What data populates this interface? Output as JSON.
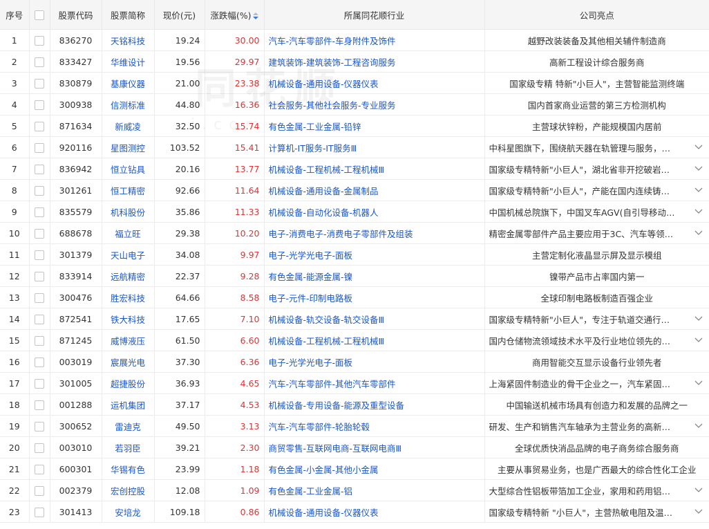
{
  "columns": {
    "index": "序号",
    "code": "股票代码",
    "name": "股票简称",
    "price": "现价(元)",
    "change": "涨跌幅(%)",
    "industry": "所属同花顺行业",
    "highlight": "公司亮点"
  },
  "watermark": "同花顺",
  "watermark_sub": "i.com",
  "sort": {
    "column": "change",
    "direction": "descending"
  },
  "colors": {
    "link": "#1a56c8",
    "rise": "#e93030",
    "header_bg": "#f5f5f5"
  },
  "rows": [
    {
      "idx": "1",
      "code": "836270",
      "name": "天铭科技",
      "price": "19.24",
      "change": "30.00",
      "industry": "汽车-汽车零部件-车身附件及饰件",
      "highlight": "越野改装装备及其他相关辅件制造商",
      "truncated": false
    },
    {
      "idx": "2",
      "code": "833427",
      "name": "华维设计",
      "price": "19.56",
      "change": "29.97",
      "industry": "建筑装饰-建筑装饰-工程咨询服务",
      "highlight": "高新工程设计综合服务商",
      "truncated": false
    },
    {
      "idx": "3",
      "code": "830879",
      "name": "基康仪器",
      "price": "21.00",
      "change": "23.38",
      "industry": "机械设备-通用设备-仪器仪表",
      "highlight": "国家级专精 特新\"小巨人\"，主营智能监测终端",
      "truncated": false
    },
    {
      "idx": "4",
      "code": "300938",
      "name": "信测标准",
      "price": "44.80",
      "change": "16.36",
      "industry": "社会服务-其他社会服务-专业服务",
      "highlight": "国内首家商业运营的第三方检测机构",
      "truncated": false
    },
    {
      "idx": "5",
      "code": "871634",
      "name": "新威凌",
      "price": "32.50",
      "change": "15.74",
      "industry": "有色金属-工业金属-铅锌",
      "highlight": "主营球状锌粉，产能规模国内居前",
      "truncated": false
    },
    {
      "idx": "6",
      "code": "920116",
      "name": "星图测控",
      "price": "103.52",
      "change": "15.41",
      "industry": "计算机-IT服务-IT服务Ⅲ",
      "highlight": "中科星图旗下，围绕航天器在轨管理与服务，…",
      "truncated": true
    },
    {
      "idx": "7",
      "code": "836942",
      "name": "恒立钻具",
      "price": "20.16",
      "change": "13.77",
      "industry": "机械设备-工程机械-工程机械Ⅲ",
      "highlight": "国家级专精特新\"小巨人\"，湖北省非开挖破岩…",
      "truncated": true
    },
    {
      "idx": "8",
      "code": "301261",
      "name": "恒工精密",
      "price": "92.66",
      "change": "11.64",
      "industry": "机械设备-通用设备-金属制品",
      "highlight": "国家级专精特新\"小巨人\"，产能在国内连续铸…",
      "truncated": true
    },
    {
      "idx": "9",
      "code": "835579",
      "name": "机科股份",
      "price": "35.86",
      "change": "11.33",
      "industry": "机械设备-自动化设备-机器人",
      "highlight": "中国机械总院旗下，中国叉车AGV(自引导移动…",
      "truncated": true
    },
    {
      "idx": "10",
      "code": "688678",
      "name": "福立旺",
      "price": "29.38",
      "change": "10.20",
      "industry": "电子-消费电子-消费电子零部件及组装",
      "highlight": "精密金属零部件产品主要应用于3C、汽车等领…",
      "truncated": true
    },
    {
      "idx": "11",
      "code": "301379",
      "name": "天山电子",
      "price": "34.08",
      "change": "9.97",
      "industry": "电子-光学光电子-面板",
      "highlight": "主营定制化液晶显示屏及显示模组",
      "truncated": false
    },
    {
      "idx": "12",
      "code": "833914",
      "name": "远航精密",
      "price": "22.37",
      "change": "9.28",
      "industry": "有色金属-能源金属-镍",
      "highlight": "镍带产品市占率国内第一",
      "truncated": false
    },
    {
      "idx": "13",
      "code": "300476",
      "name": "胜宏科技",
      "price": "64.66",
      "change": "8.58",
      "industry": "电子-元件-印制电路板",
      "highlight": "全球印制电路板制造百强企业",
      "truncated": false
    },
    {
      "idx": "14",
      "code": "872541",
      "name": "铁大科技",
      "price": "17.65",
      "change": "7.10",
      "industry": "机械设备-轨交设备-轨交设备Ⅲ",
      "highlight": "国家级专精特新\"小巨人\"，专注于轨道交通行…",
      "truncated": true
    },
    {
      "idx": "15",
      "code": "871245",
      "name": "威博液压",
      "price": "61.50",
      "change": "6.60",
      "industry": "机械设备-工程机械-工程机械Ⅲ",
      "highlight": "国内仓储物流领域技术水平及行业地位领先的…",
      "truncated": true
    },
    {
      "idx": "16",
      "code": "003019",
      "name": "宸展光电",
      "price": "37.30",
      "change": "6.36",
      "industry": "电子-光学光电子-面板",
      "highlight": "商用智能交互显示设备行业领先者",
      "truncated": false
    },
    {
      "idx": "17",
      "code": "301005",
      "name": "超捷股份",
      "price": "36.93",
      "change": "4.65",
      "industry": "汽车-汽车零部件-其他汽车零部件",
      "highlight": "上海紧固件制造业的骨干企业之一，汽车紧固…",
      "truncated": true
    },
    {
      "idx": "18",
      "code": "001288",
      "name": "运机集团",
      "price": "37.17",
      "change": "4.53",
      "industry": "机械设备-专用设备-能源及重型设备",
      "highlight": "中国输送机械市场具有创造力和发展的品牌之一",
      "truncated": false
    },
    {
      "idx": "19",
      "code": "300652",
      "name": "雷迪克",
      "price": "49.50",
      "change": "3.13",
      "industry": "汽车-汽车零部件-轮胎轮毂",
      "highlight": "研发、生产和销售汽车轴承为主营业务的高新…",
      "truncated": true
    },
    {
      "idx": "20",
      "code": "003010",
      "name": "若羽臣",
      "price": "39.21",
      "change": "2.30",
      "industry": "商贸零售-互联网电商-互联网电商Ⅲ",
      "highlight": "全球优质快消品品牌的电子商务综合服务商",
      "truncated": false
    },
    {
      "idx": "21",
      "code": "600301",
      "name": "华锡有色",
      "price": "23.99",
      "change": "1.18",
      "industry": "有色金属-小金属-其他小金属",
      "highlight": "主要从事贸易业务，也是广西最大的综合性化工企业",
      "truncated": false
    },
    {
      "idx": "22",
      "code": "002379",
      "name": "宏创控股",
      "price": "12.08",
      "change": "1.09",
      "industry": "有色金属-工业金属-铝",
      "highlight": "大型综合性铝板带箔加工企业，家用和药用铝…",
      "truncated": true
    },
    {
      "idx": "23",
      "code": "301413",
      "name": "安培龙",
      "price": "109.18",
      "change": "0.86",
      "industry": "机械设备-通用设备-仪器仪表",
      "highlight": "国家级专精特新 \"小巨人\"，主营热敏电阻及温…",
      "truncated": true
    }
  ]
}
